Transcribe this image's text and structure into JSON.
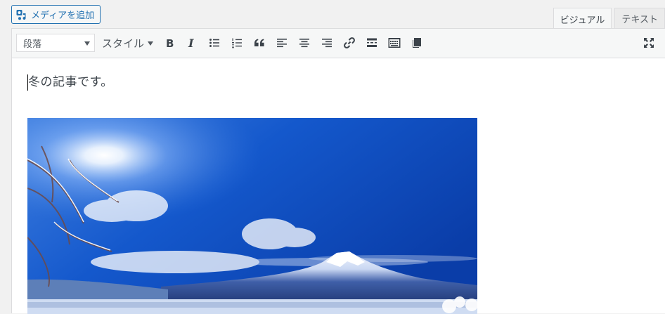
{
  "toolbar_top": {
    "add_media_label": "メディアを追加",
    "tabs": [
      {
        "label": "ビジュアル",
        "active": true
      },
      {
        "label": "テキスト",
        "active": false
      }
    ]
  },
  "editor_toolbar": {
    "format_value": "段落",
    "style_label": "スタイル",
    "buttons": [
      "bold",
      "italic",
      "bulleted-list",
      "numbered-list",
      "blockquote",
      "align-left",
      "align-center",
      "align-right",
      "insert-link",
      "read-more",
      "toolbar-toggle",
      "paste-as-text",
      "fullscreen"
    ]
  },
  "content": {
    "paragraph": "冬の記事です。",
    "image_subject": "snow-capped-mountain-winter-photo"
  },
  "colors": {
    "accent": "#2271b1",
    "toolbar_bg": "#f6f7f7",
    "page_bg": "#f1f1f1",
    "border": "#dcdcde"
  }
}
